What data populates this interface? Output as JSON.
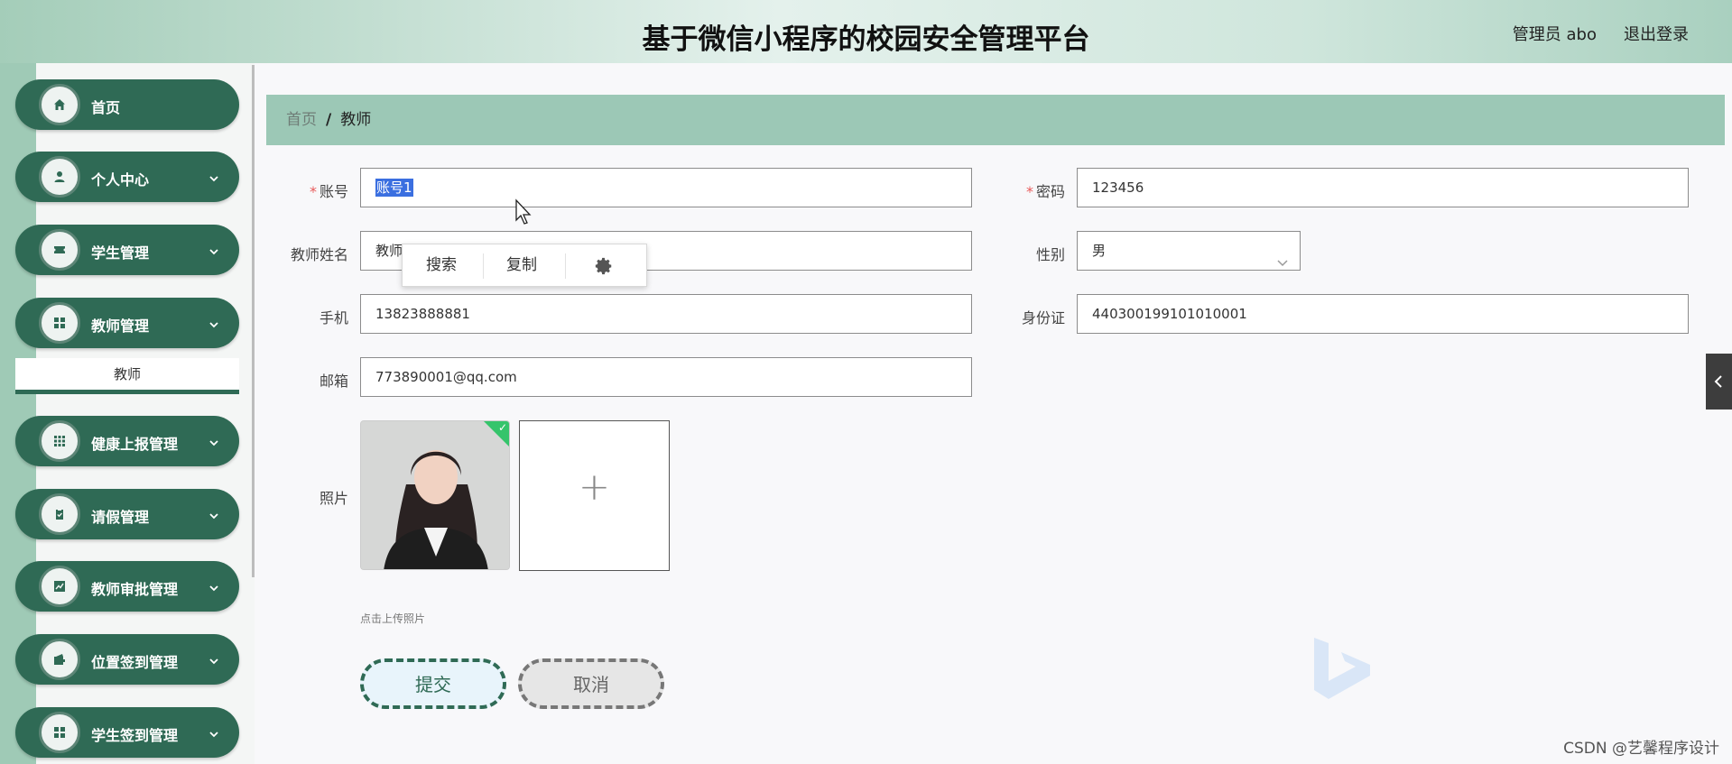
{
  "header": {
    "title": "基于微信小程序的校园安全管理平台",
    "user": "管理员 abo",
    "logout": "退出登录"
  },
  "sidebar": {
    "items": [
      {
        "label": "首页",
        "icon": "home-icon"
      },
      {
        "label": "个人中心",
        "icon": "user-icon"
      },
      {
        "label": "学生管理",
        "icon": "ticket-icon"
      },
      {
        "label": "教师管理",
        "icon": "grid-icon"
      },
      {
        "label": "健康上报管理",
        "icon": "dots-grid-icon"
      },
      {
        "label": "请假管理",
        "icon": "clipboard-icon"
      },
      {
        "label": "教师审批管理",
        "icon": "chart-icon"
      },
      {
        "label": "位置签到管理",
        "icon": "wallet-icon"
      },
      {
        "label": "学生签到管理",
        "icon": "grid-icon"
      }
    ],
    "submenu_active": "教师"
  },
  "breadcrumb": {
    "home": "首页",
    "separator": "/",
    "current": "教师"
  },
  "form": {
    "account": {
      "label": "账号",
      "value": "账号1"
    },
    "password": {
      "label": "密码",
      "value": "123456"
    },
    "teacher_name": {
      "label": "教师姓名",
      "value": "教师"
    },
    "gender": {
      "label": "性别",
      "value": "男"
    },
    "phone": {
      "label": "手机",
      "value": "13823888881"
    },
    "id_card": {
      "label": "身份证",
      "value": "440300199101010001"
    },
    "email": {
      "label": "邮箱",
      "value": "773890001@qq.com"
    },
    "photo": {
      "label": "照片",
      "hint": "点击上传照片"
    },
    "submit": "提交",
    "cancel": "取消"
  },
  "popup": {
    "search": "搜索",
    "copy": "复制"
  },
  "watermark": "CSDN @艺馨程序设计",
  "colors": {
    "sidebar_bg": "#2f6a55",
    "breadcrumb_bg": "#9cc8b6",
    "required": "#e85a5a"
  }
}
